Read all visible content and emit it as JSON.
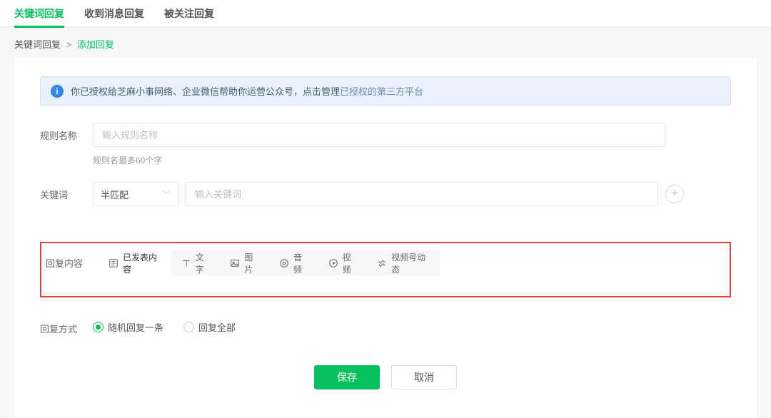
{
  "tabs": {
    "items": [
      "关键词回复",
      "收到消息回复",
      "被关注回复"
    ],
    "active_index": 0
  },
  "breadcrumb": {
    "root": "关键词回复",
    "sep": ">",
    "current": "添加回复"
  },
  "alert": {
    "text_before_link": "你已授权给芝麻小事网络、企业微信帮助你运营公众号，点击管理",
    "link_text": "已授权的第三方平台"
  },
  "form": {
    "rule_name": {
      "label": "规则名称",
      "placeholder": "输入规则名称",
      "hint": "规则名最多60个字"
    },
    "keyword": {
      "label": "关键词",
      "match_mode": "半匹配",
      "placeholder": "输入关键词"
    },
    "reply_content": {
      "label": "回复内容",
      "items": [
        {
          "name": "article",
          "label": "已发表内容"
        },
        {
          "name": "text",
          "label": "文字"
        },
        {
          "name": "image",
          "label": "图片"
        },
        {
          "name": "audio",
          "label": "音频"
        },
        {
          "name": "video",
          "label": "视频"
        },
        {
          "name": "channels",
          "label": "视频号动态"
        }
      ]
    },
    "reply_mode": {
      "label": "回复方式",
      "options": [
        "随机回复一条",
        "回复全部"
      ],
      "selected_index": 0
    }
  },
  "actions": {
    "save": "保存",
    "cancel": "取消"
  }
}
